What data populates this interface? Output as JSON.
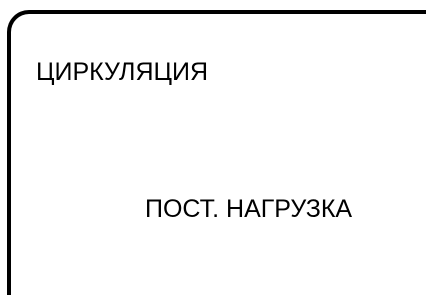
{
  "display": {
    "menu_title": "ЦИРКУЛЯЦИЯ",
    "menu_value": "ПОСТ. НАГРУЗКА"
  },
  "colors": {
    "background": "#ffffff",
    "foreground": "#000000"
  }
}
